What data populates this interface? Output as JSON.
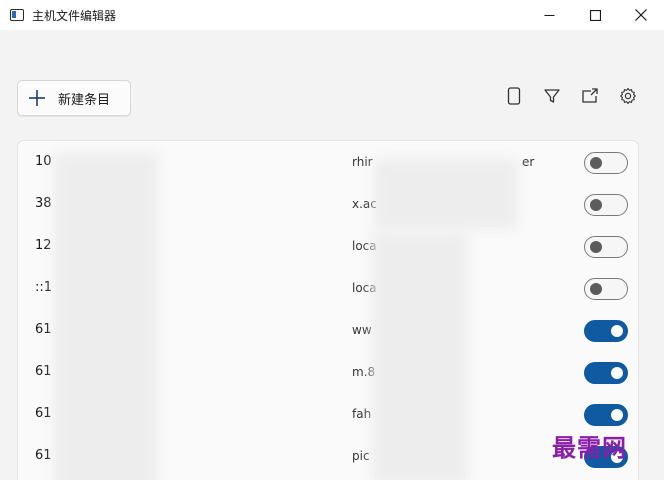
{
  "window": {
    "title": "主机文件编辑器",
    "minimize_glyph": "—",
    "maximize_glyph": "☐",
    "close_glyph": "✕"
  },
  "toolbar": {
    "new_entry_label": "新建条目",
    "icons": [
      "phone-icon",
      "filter-icon",
      "export-icon",
      "gear-icon"
    ]
  },
  "entries": [
    {
      "addr": "10",
      "host": "rhir",
      "host_tail": "er",
      "enabled": false
    },
    {
      "addr": "38",
      "host": "x.ac",
      "host_tail": "",
      "enabled": false
    },
    {
      "addr": "12",
      "host": "loca",
      "host_tail": "",
      "enabled": false
    },
    {
      "addr": "::1",
      "host": "loca",
      "host_tail": "",
      "enabled": false
    },
    {
      "addr": "61",
      "host": "ww",
      "host_tail": "",
      "enabled": true
    },
    {
      "addr": "61",
      "host": "m.8",
      "host_tail": "",
      "enabled": true
    },
    {
      "addr": "61",
      "host": "fah",
      "host_tail": "",
      "enabled": true
    },
    {
      "addr": "61",
      "host": "pic",
      "host_tail": "",
      "enabled": true
    }
  ],
  "colors": {
    "toggle_on": "#0f5aa0",
    "toggle_off_knob": "#5c5c5c",
    "watermark": "#8a1ea8"
  },
  "watermark": "最需网"
}
